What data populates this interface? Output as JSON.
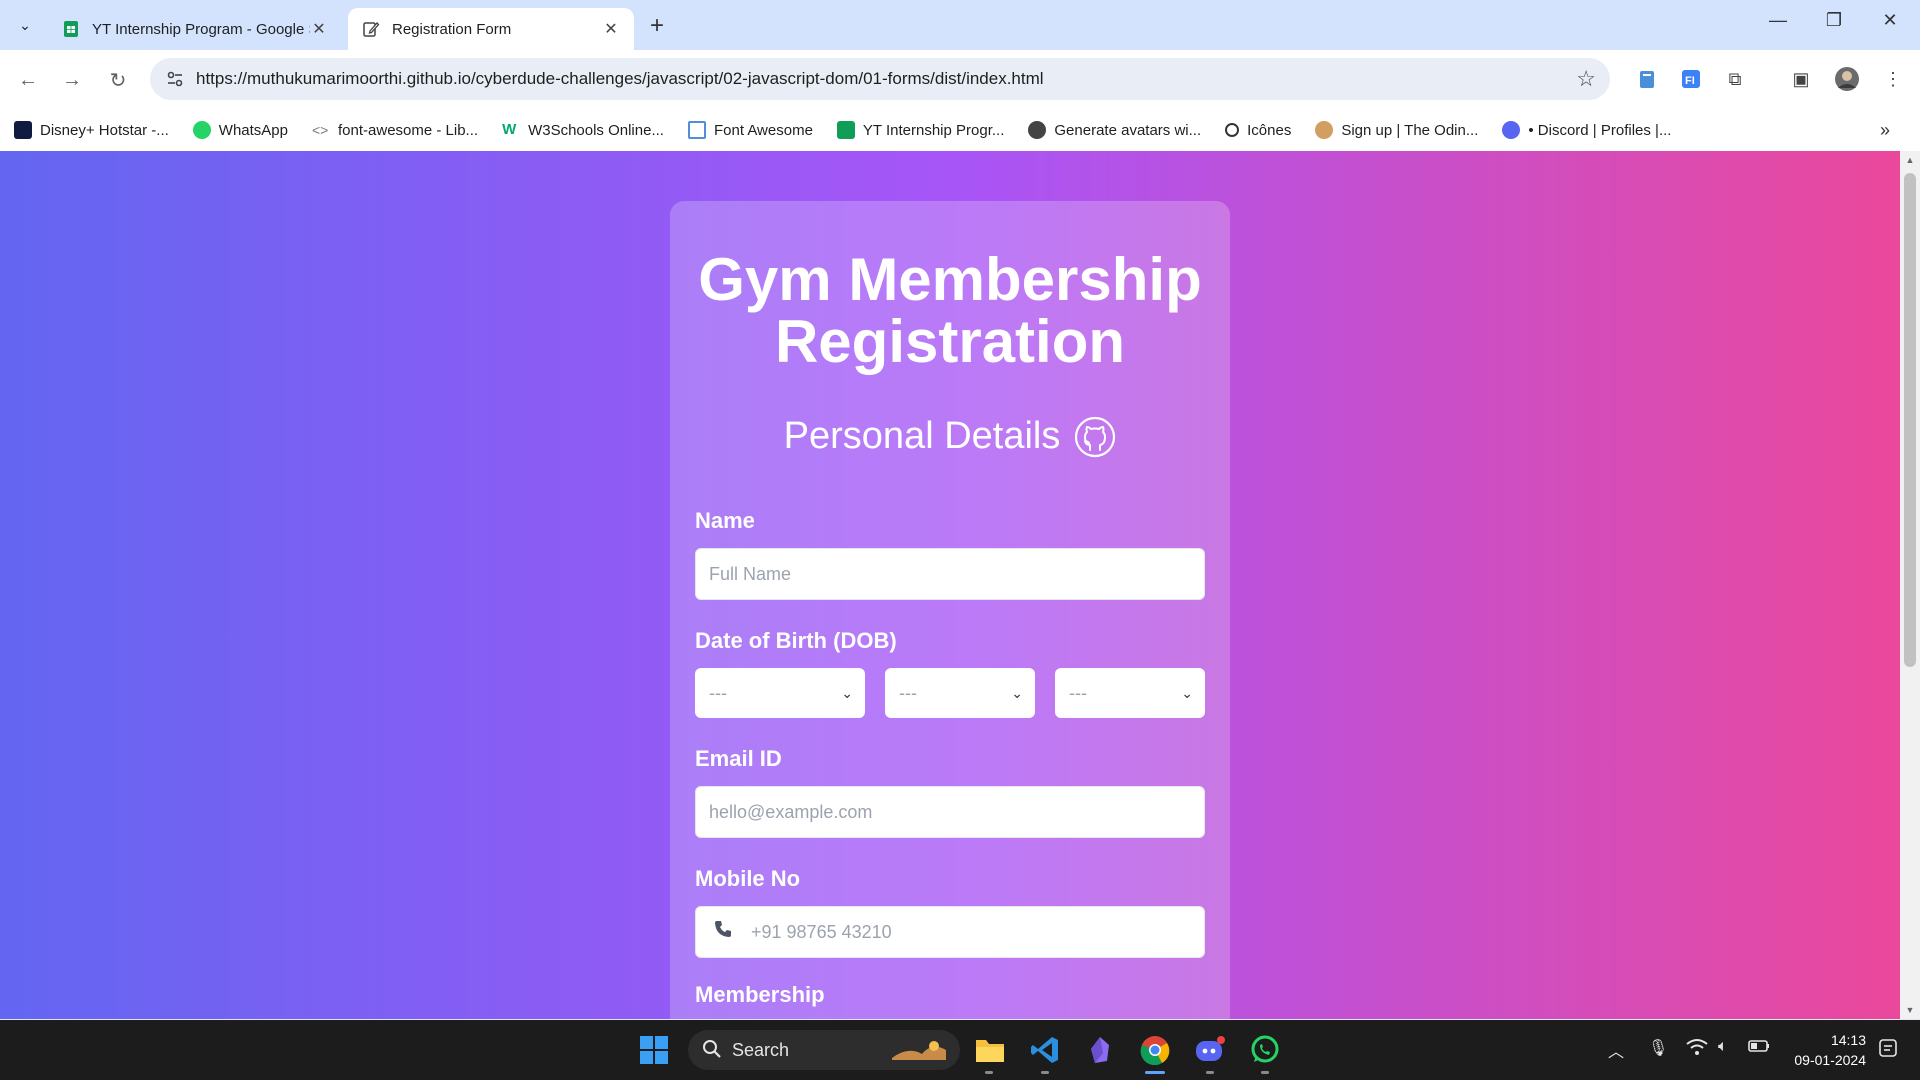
{
  "browser": {
    "tabs": [
      {
        "title": "YT Internship Program - Google Sheets",
        "active": false
      },
      {
        "title": "Registration Form",
        "active": true
      }
    ],
    "url": "https://muthukumarimoorthi.github.io/cyberdude-challenges/javascript/02-javascript-dom/01-forms/dist/index.html",
    "bookmarks": [
      {
        "label": "Disney+ Hotstar -...",
        "color": "#0f1c3f"
      },
      {
        "label": "WhatsApp",
        "color": "#25d366"
      },
      {
        "label": "font-awesome - Lib...",
        "color": "#777777"
      },
      {
        "label": "W3Schools Online...",
        "color": "#04aa6d"
      },
      {
        "label": "Font Awesome",
        "color": "#538dd7"
      },
      {
        "label": "YT Internship Progr...",
        "color": "#0f9d58"
      },
      {
        "label": "Generate avatars wi...",
        "color": "#444444"
      },
      {
        "label": "Icônes",
        "color": "#333333"
      },
      {
        "label": "Sign up | The Odin...",
        "color": "#d1a060"
      },
      {
        "label": "• Discord | Profiles |...",
        "color": "#5865f2"
      }
    ]
  },
  "form": {
    "title": "Gym Membership Registration",
    "section_title": "Personal Details",
    "name_label": "Name",
    "name_placeholder": "Full Name",
    "dob_label": "Date of Birth (DOB)",
    "dob_day": "---",
    "dob_month": "---",
    "dob_year": "---",
    "email_label": "Email ID",
    "email_placeholder": "hello@example.com",
    "mobile_label": "Mobile No",
    "mobile_placeholder": "+91 98765 43210",
    "membership_label": "Membership"
  },
  "taskbar": {
    "search_label": "Search",
    "time": "14:13",
    "date": "09-01-2024"
  },
  "colors": {
    "gradient_start": "#6366f1",
    "gradient_mid": "#a855f7",
    "gradient_end": "#ec4899"
  }
}
